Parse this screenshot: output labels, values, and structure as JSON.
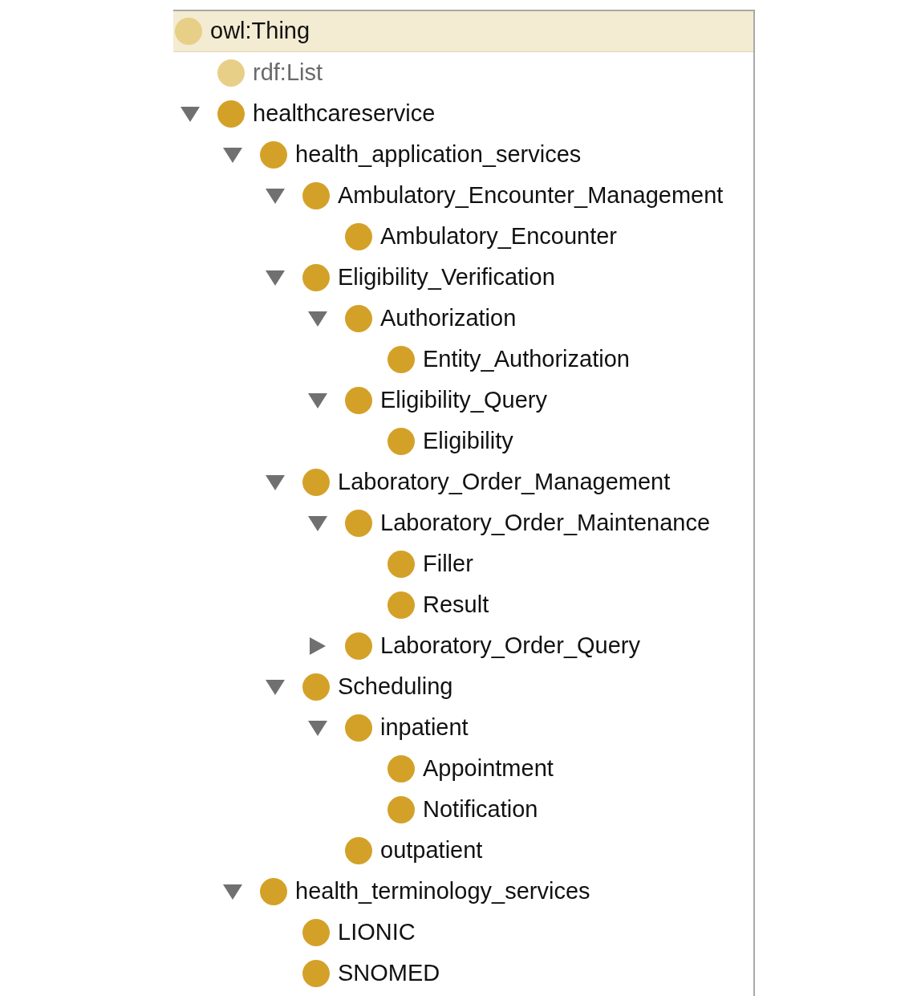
{
  "tree": [
    {
      "label": "owl:Thing",
      "kind": "root",
      "selected": true,
      "children": [
        {
          "label": "rdf:List",
          "kind": "builtin",
          "selected": false
        },
        {
          "label": "healthcareservice",
          "kind": "class",
          "selected": false,
          "expanded": true,
          "children": [
            {
              "label": "health_application_services",
              "kind": "class",
              "selected": false,
              "expanded": true,
              "children": [
                {
                  "label": "Ambulatory_Encounter_Management",
                  "kind": "class",
                  "selected": false,
                  "expanded": true,
                  "children": [
                    {
                      "label": "Ambulatory_Encounter",
                      "kind": "class",
                      "selected": false
                    }
                  ]
                },
                {
                  "label": "Eligibility_Verification",
                  "kind": "class",
                  "selected": false,
                  "expanded": true,
                  "children": [
                    {
                      "label": "Authorization",
                      "kind": "class",
                      "selected": false,
                      "expanded": true,
                      "children": [
                        {
                          "label": "Entity_Authorization",
                          "kind": "class",
                          "selected": false
                        }
                      ]
                    },
                    {
                      "label": "Eligibility_Query",
                      "kind": "class",
                      "selected": false,
                      "expanded": true,
                      "children": [
                        {
                          "label": "Eligibility",
                          "kind": "class",
                          "selected": false
                        }
                      ]
                    }
                  ]
                },
                {
                  "label": "Laboratory_Order_Management",
                  "kind": "class",
                  "selected": false,
                  "expanded": true,
                  "children": [
                    {
                      "label": "Laboratory_Order_Maintenance",
                      "kind": "class",
                      "selected": false,
                      "expanded": true,
                      "children": [
                        {
                          "label": "Filler",
                          "kind": "class",
                          "selected": false
                        },
                        {
                          "label": "Result",
                          "kind": "class",
                          "selected": false
                        }
                      ]
                    },
                    {
                      "label": "Laboratory_Order_Query",
                      "kind": "class",
                      "selected": false,
                      "expanded": false
                    }
                  ]
                },
                {
                  "label": "Scheduling",
                  "kind": "class",
                  "selected": false,
                  "expanded": true,
                  "children": [
                    {
                      "label": "inpatient",
                      "kind": "class",
                      "selected": false,
                      "expanded": true,
                      "children": [
                        {
                          "label": "Appointment",
                          "kind": "class",
                          "selected": false
                        },
                        {
                          "label": "Notification",
                          "kind": "class",
                          "selected": false
                        }
                      ]
                    },
                    {
                      "label": "outpatient",
                      "kind": "class",
                      "selected": false
                    }
                  ]
                }
              ]
            },
            {
              "label": "health_terminology_services",
              "kind": "class",
              "selected": false,
              "expanded": true,
              "children": [
                {
                  "label": "LIONIC",
                  "kind": "class",
                  "selected": false
                },
                {
                  "label": "SNOMED",
                  "kind": "class",
                  "selected": false
                }
              ]
            }
          ]
        }
      ]
    }
  ]
}
